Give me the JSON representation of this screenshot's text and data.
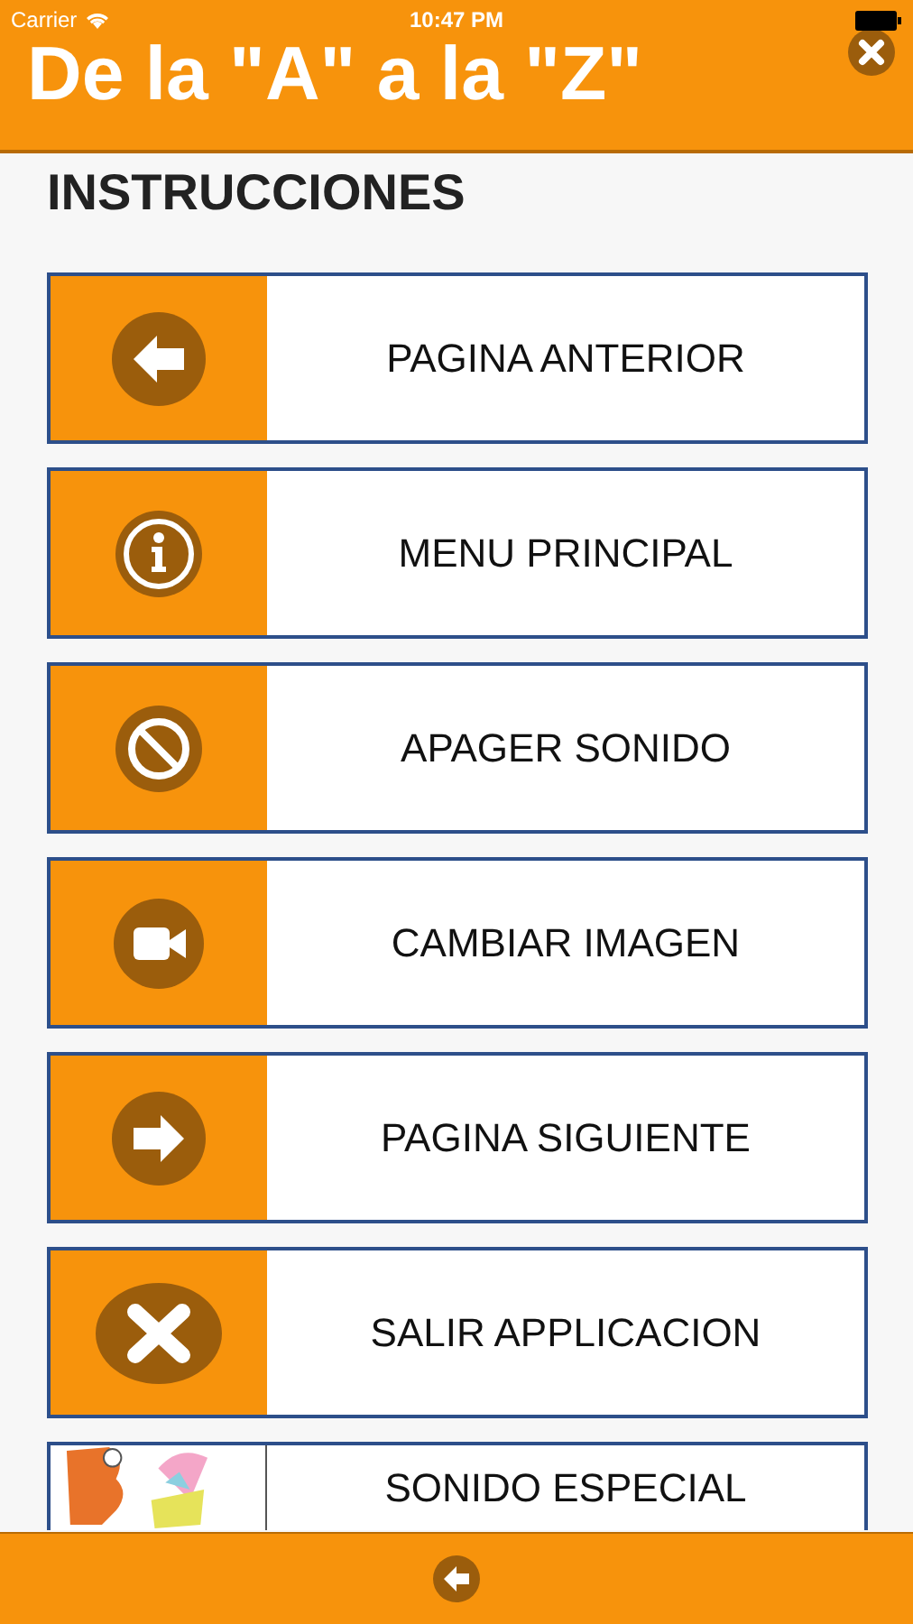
{
  "status_bar": {
    "carrier": "Carrier",
    "time": "10:47 PM"
  },
  "header": {
    "title": "De la \"A\" a la \"Z\""
  },
  "section_title": "INSTRUCCIONES",
  "items": [
    {
      "kind": "back",
      "label": "PAGINA ANTERIOR"
    },
    {
      "kind": "info",
      "label": "MENU PRINCIPAL"
    },
    {
      "kind": "mute",
      "label": "APAGER SONIDO"
    },
    {
      "kind": "video",
      "label": "CAMBIAR IMAGEN"
    },
    {
      "kind": "next",
      "label": "PAGINA SIGUIENTE"
    },
    {
      "kind": "exit",
      "label": "SALIR APPLICACION"
    },
    {
      "kind": "picture",
      "label": "SONIDO ESPECIAL"
    }
  ]
}
